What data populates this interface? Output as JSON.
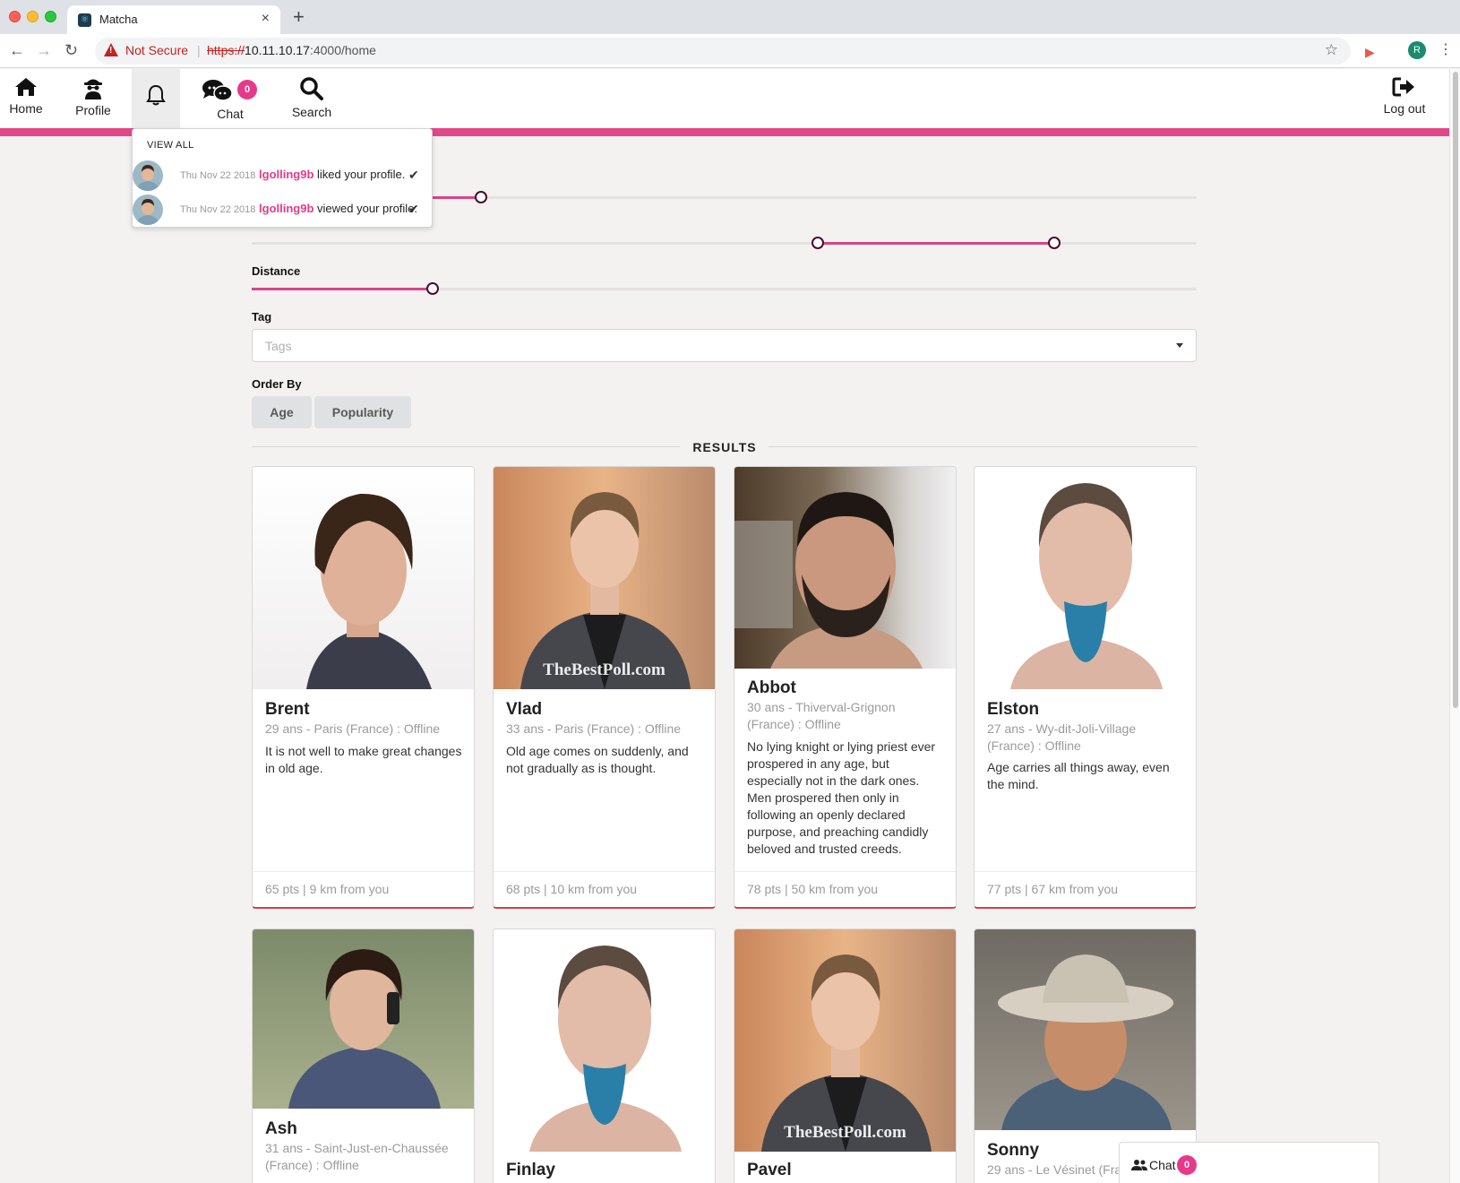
{
  "browser": {
    "tab_title": "Matcha",
    "security_label": "Not Secure",
    "url_scheme": "https://",
    "url_host": "10.11.10.17",
    "url_rest": ":4000/home",
    "profile_initial": "R"
  },
  "nav": {
    "home": "Home",
    "profile": "Profile",
    "chat": "Chat",
    "chat_count": "0",
    "search": "Search",
    "logout": "Log out"
  },
  "notifications": {
    "view_all": "VIEW ALL",
    "items": [
      {
        "date": "Thu Nov 22 2018",
        "user": "lgolling9b",
        "action": "liked your profile."
      },
      {
        "date": "Thu Nov 22 2018",
        "user": "lgolling9b",
        "action": "viewed your profile."
      }
    ]
  },
  "filters": {
    "age_range": [
      0,
      0.24
    ],
    "popularity_range": [
      0.6,
      0.85
    ],
    "distance_label": "Distance",
    "distance_value": 0.19,
    "tag_label": "Tag",
    "tag_placeholder": "Tags",
    "order_label": "Order By",
    "order_age": "Age",
    "order_popularity": "Popularity"
  },
  "results": {
    "title": "RESULTS",
    "cards": [
      {
        "name": "Brent",
        "meta": "29 ans - Paris (France) : Offline",
        "desc": "It is not well to make great changes in old age.",
        "foot": "65 pts | 9 km from you"
      },
      {
        "name": "Vlad",
        "meta": "33 ans - Paris (France) : Offline",
        "desc": "Old age comes on suddenly, and not gradually as is thought.",
        "foot": "68 pts | 10 km from you",
        "watermark": "TheBestPoll.com"
      },
      {
        "name": "Abbot",
        "meta": "30 ans - Thiverval-Grignon (France) : Offline",
        "desc": "No lying knight or lying priest ever prospered in any age, but especially not in the dark ones. Men prospered then only in following an openly declared purpose, and preaching candidly beloved and trusted creeds.",
        "foot": "78 pts | 50 km from you"
      },
      {
        "name": "Elston",
        "meta": "27 ans - Wy-dit-Joli-Village (France) : Offline",
        "desc": "Age carries all things away, even the mind.",
        "foot": "77 pts | 67 km from you"
      },
      {
        "name": "Ash",
        "meta": "31 ans - Saint-Just-en-Chaussée (France) : Offline"
      },
      {
        "name": "Finlay"
      },
      {
        "name": "Pavel",
        "watermark": "TheBestPoll.com"
      },
      {
        "name": "Sonny",
        "meta": "29 ans - Le Vésinet (Fra"
      }
    ]
  },
  "chat_widget": {
    "label": "Chat",
    "count": "0"
  },
  "colors": {
    "accent": "#e2478a",
    "slider_handle": "#4a0b2d",
    "card_border": "#d3424b"
  }
}
